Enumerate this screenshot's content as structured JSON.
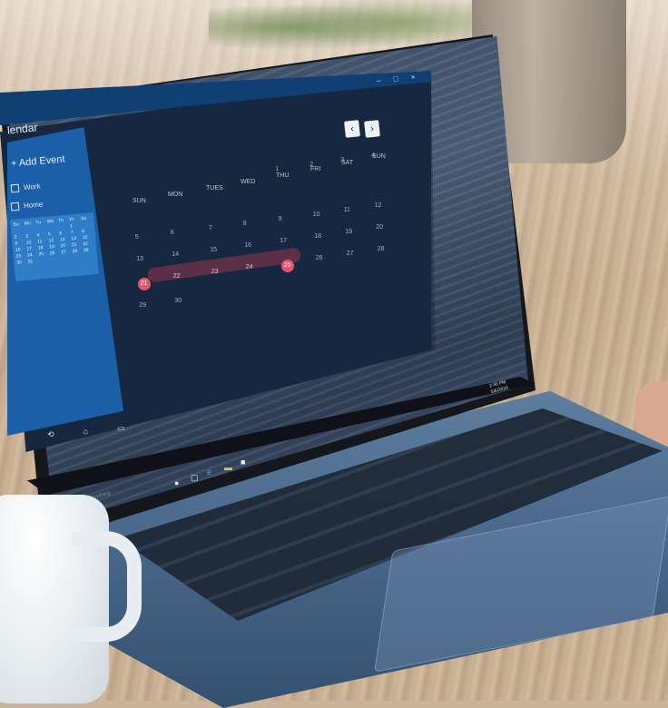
{
  "window": {
    "title": "lendar",
    "controls": "– □ ×"
  },
  "sidebar": {
    "add_event": "+ Add Event",
    "categories": [
      {
        "label": "Work"
      },
      {
        "label": "Home"
      }
    ],
    "mini_calendar": {
      "headers": [
        "Su",
        "Mo",
        "Tu",
        "We",
        "Th",
        "Fr",
        "Sa"
      ],
      "days": [
        "",
        "",
        "",
        "",
        "",
        "1",
        "",
        "2",
        "3",
        "4",
        "5",
        "6",
        "7",
        "8",
        "9",
        "10",
        "11",
        "12",
        "13",
        "14",
        "15",
        "16",
        "17",
        "18",
        "19",
        "20",
        "21",
        "22",
        "23",
        "24",
        "25",
        "26",
        "27",
        "28",
        "29",
        "30",
        "31",
        "",
        "",
        "",
        "",
        ""
      ]
    }
  },
  "nav": {
    "prev": "‹",
    "next": "›"
  },
  "calendar": {
    "day_names": [
      "SUN",
      "MON",
      "TUES",
      "WED",
      "THU",
      "FRI",
      "SAT",
      "SUN"
    ],
    "row0": [
      "1",
      "2",
      "3",
      "4"
    ],
    "row1": [
      "5",
      "6",
      "7",
      "8",
      "9",
      "10",
      "11",
      "12"
    ],
    "row2": [
      "13",
      "14",
      "15",
      "16",
      "17",
      "18",
      "19",
      "20"
    ],
    "row3": [
      "21",
      "22",
      "23",
      "24",
      "25",
      "26",
      "27",
      "28"
    ],
    "row4": [
      "29",
      "30"
    ],
    "highlight_start": "21",
    "highlight_end": "25",
    "accent_color": "#e0566e"
  },
  "taskbar": {
    "search_placeholder": "Ask me anything",
    "time": "2:30 PM",
    "date": "5/6/2020"
  }
}
